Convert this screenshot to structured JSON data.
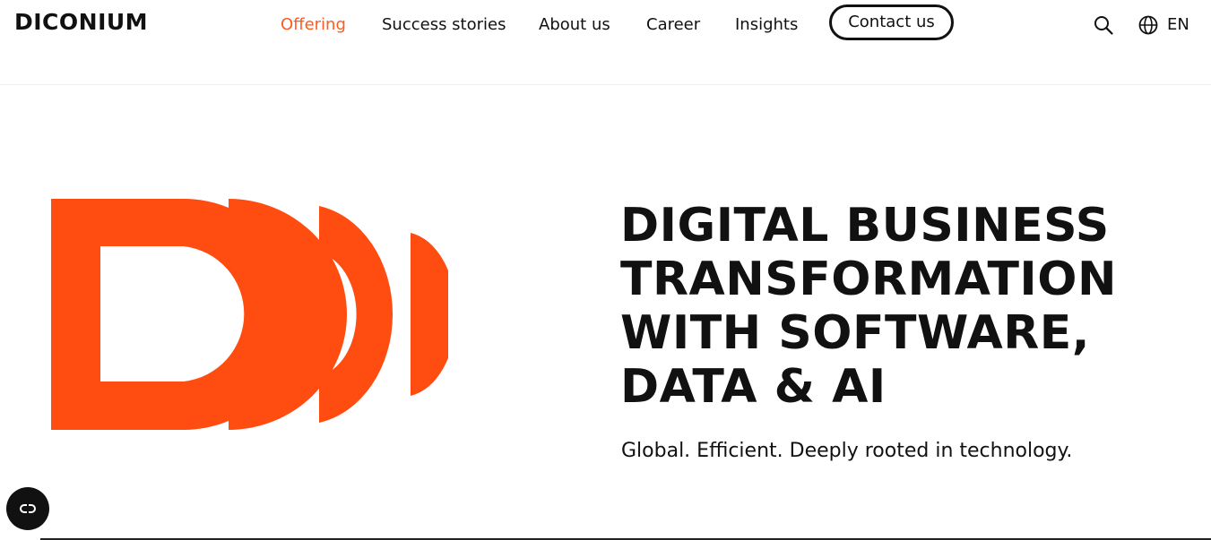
{
  "brand": {
    "logo_text": "DICONIUM",
    "accent_color": "#ff5a1f",
    "text_color": "#111111"
  },
  "nav": {
    "items": [
      {
        "label": "Offering",
        "active": true
      },
      {
        "label": "Success stories",
        "active": false
      },
      {
        "label": "About us",
        "active": false
      },
      {
        "label": "Career",
        "active": false
      },
      {
        "label": "Insights",
        "active": false
      }
    ],
    "contact_label": "Contact us",
    "search_icon": "search-icon",
    "language_icon": "globe-icon",
    "language_label": "EN"
  },
  "hero": {
    "graphic_icon": "diconium-d-logo-mark",
    "title": "DIGITAL BUSINESS\nTRANSFORMATION\nWITH SOFTWARE,\nDATA & AI",
    "subtitle": "Global. Efficient. Deeply rooted in technology."
  },
  "floating": {
    "icon": "cookie-settings-icon"
  }
}
